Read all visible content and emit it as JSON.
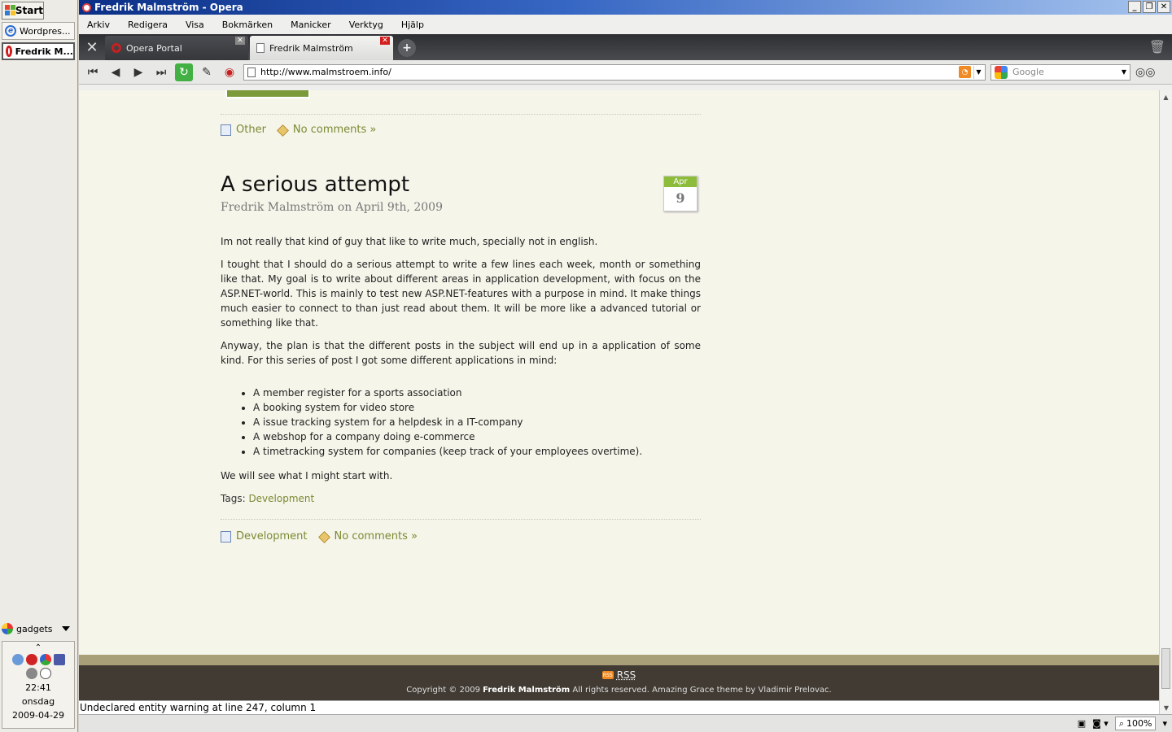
{
  "taskbar": {
    "start_label": "Start",
    "tasks": [
      {
        "label": "Wordpres...",
        "icon": "ie-icon"
      },
      {
        "label": "Fredrik M...",
        "icon": "opera-icon"
      }
    ],
    "gadgets_label": "gadgets",
    "tray": {
      "time": "22:41",
      "day": "onsdag",
      "date": "2009-04-29"
    }
  },
  "window": {
    "title": "Fredrik Malmström - Opera",
    "controls": [
      "_",
      "❐",
      "✕"
    ]
  },
  "menu": [
    "Arkiv",
    "Redigera",
    "Visa",
    "Bokmärken",
    "Manicker",
    "Verktyg",
    "Hjälp"
  ],
  "tabs": [
    {
      "label": "Opera Portal",
      "active": false
    },
    {
      "label": "Fredrik Malmström",
      "active": true
    }
  ],
  "address": {
    "url": "http://www.malmstroem.info/",
    "search_placeholder": "Google"
  },
  "page": {
    "prev_post_meta": {
      "category": "Other",
      "comments": "No comments »"
    },
    "post": {
      "title": "A serious attempt",
      "byline": "Fredrik Malmström on April 9th, 2009",
      "calendar": {
        "month": "Apr",
        "day": "9"
      },
      "paragraphs": [
        "Im not really that kind of guy that like to write much, specially not in english.",
        "I tought that I should do a serious attempt to write a few lines each week, month or something like that. My goal is to write about different areas in application development, with focus on the ASP.NET-world. This is mainly to test new ASP.NET-features with a purpose in mind. It make things much easier to connect to than just read about them. It will be more like a advanced tutorial or something like that.",
        "Anyway, the plan is that the different posts in the subject  will end up in a application of some kind. For this series of post I got some  different applications in mind:"
      ],
      "list": [
        "A member register for a sports association",
        "A booking system for video store",
        "A issue tracking system for a helpdesk in a IT-company",
        "A webshop for a company doing e-commerce",
        "A timetracking system for companies (keep track of your employees overtime)."
      ],
      "closing": "We will see what I might start with.",
      "tags_label": "Tags:",
      "tag": "Development",
      "meta": {
        "category": "Development",
        "comments": "No comments »"
      }
    },
    "footer": {
      "rss": "RSS",
      "copy_prefix": "Copyright © 2009",
      "copy_author": "Fredrik Malmström",
      "copy_suffix": "All rights reserved. Amazing Grace theme by Vladimir Prelovac."
    }
  },
  "status": {
    "message": "Undeclared entity warning at line 247, column 1",
    "zoom": "100%"
  }
}
